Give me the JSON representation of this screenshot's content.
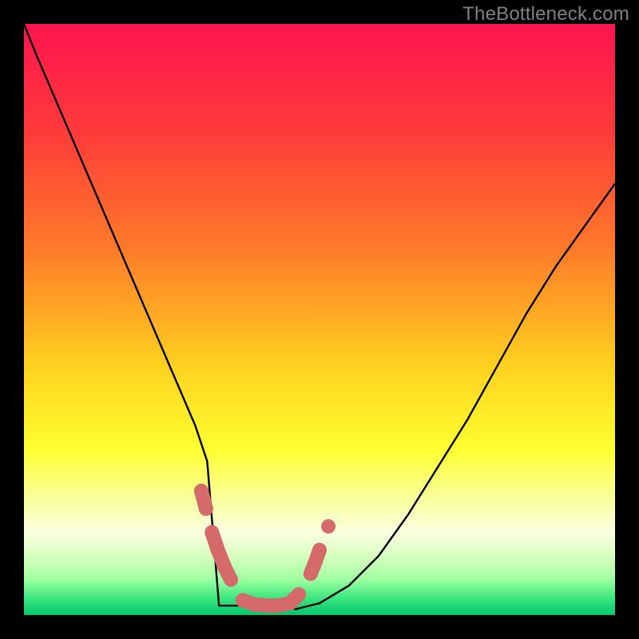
{
  "watermark": "TheBottleneck.com",
  "chart_data": {
    "type": "line",
    "title": "",
    "xlabel": "",
    "ylabel": "",
    "xlim": [
      0,
      100
    ],
    "ylim": [
      0,
      100
    ],
    "series": [
      {
        "name": "bottleneck-curve",
        "x": [
          0,
          2,
          5,
          8,
          11,
          14,
          17,
          20,
          23,
          26,
          29,
          31,
          33,
          35,
          37,
          39,
          41,
          43,
          46,
          50,
          55,
          60,
          65,
          70,
          75,
          80,
          85,
          90,
          95,
          100
        ],
        "y": [
          100,
          95,
          88,
          81,
          74,
          67,
          60,
          53,
          46,
          39,
          32,
          26,
          21,
          16,
          12,
          8,
          5,
          3,
          1,
          2,
          5,
          10,
          17,
          25,
          33,
          42,
          51,
          59,
          66,
          73
        ]
      }
    ],
    "flat_zone": {
      "x_start": 32,
      "x_end": 43
    },
    "markers": {
      "name": "dash-markers",
      "color": "#d46a6a",
      "points": [
        {
          "x": 30.0,
          "y": 21.0
        },
        {
          "x": 30.8,
          "y": 18.0
        },
        {
          "x": 31.8,
          "y": 14.0
        },
        {
          "x": 32.8,
          "y": 11.0
        },
        {
          "x": 34.0,
          "y": 8.0
        },
        {
          "x": 35.0,
          "y": 6.0
        },
        {
          "x": 37.0,
          "y": 2.5
        },
        {
          "x": 39.0,
          "y": 1.8
        },
        {
          "x": 41.0,
          "y": 1.6
        },
        {
          "x": 43.0,
          "y": 1.6
        },
        {
          "x": 45.0,
          "y": 2.0
        },
        {
          "x": 46.5,
          "y": 3.5
        },
        {
          "x": 48.5,
          "y": 7.0
        },
        {
          "x": 49.3,
          "y": 9.0
        },
        {
          "x": 50.0,
          "y": 11.0
        },
        {
          "x": 51.5,
          "y": 15.0
        }
      ]
    },
    "gradient_stops": [
      {
        "offset": 0.0,
        "color": "#ff1450"
      },
      {
        "offset": 0.18,
        "color": "#ff3a3a"
      },
      {
        "offset": 0.38,
        "color": "#ff7a2a"
      },
      {
        "offset": 0.58,
        "color": "#ffd21f"
      },
      {
        "offset": 0.72,
        "color": "#ffff30"
      },
      {
        "offset": 0.82,
        "color": "#f8ffb0"
      },
      {
        "offset": 0.86,
        "color": "#fbffe0"
      },
      {
        "offset": 0.9,
        "color": "#d8ffc0"
      },
      {
        "offset": 0.94,
        "color": "#9effa0"
      },
      {
        "offset": 0.97,
        "color": "#40e880"
      },
      {
        "offset": 1.0,
        "color": "#00c86e"
      }
    ]
  }
}
